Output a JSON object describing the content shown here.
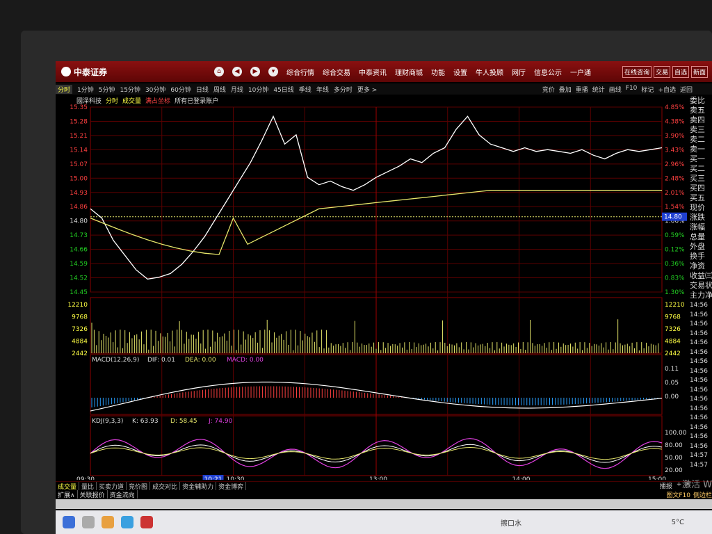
{
  "window": {
    "app_name": "中泰证券"
  },
  "nav": {
    "items": [
      "综合行情",
      "综合交易",
      "中泰资讯",
      "理财商城",
      "功能",
      "设置",
      "牛人投顾",
      "网厅",
      "信息公示",
      "一户通"
    ],
    "right_buttons": [
      "在线咨询",
      "交易",
      "自选",
      "新面"
    ]
  },
  "toolbar": {
    "periods": [
      "分时",
      "1分钟",
      "5分钟",
      "15分钟",
      "30分钟",
      "60分钟",
      "日线",
      "周线",
      "月线",
      "10分钟",
      "45日线",
      "季线",
      "年线",
      "多分时",
      "更多 >"
    ],
    "right": [
      "竞价",
      "叠加",
      "重播",
      "统计",
      "画线",
      "F10",
      "标记",
      "+自选",
      "返回"
    ]
  },
  "legend": {
    "stock": "國泽科技",
    "mode": "分时",
    "volume": "成交量",
    "coord": "满占坐标",
    "accounts": "所有已登录账户"
  },
  "price_axis": {
    "left": [
      "15.35",
      "15.28",
      "15.21",
      "15.14",
      "15.07",
      "15.00",
      "14.93",
      "14.86",
      "14.80",
      "14.73",
      "14.66",
      "14.59",
      "14.52",
      "14.45"
    ],
    "right": [
      "4.85%",
      "4.38%",
      "3.90%",
      "3.43%",
      "2.96%",
      "2.48%",
      "2.01%",
      "1.54%",
      "1.06%",
      "0.59%",
      "0.12%",
      "0.36%",
      "0.83%",
      "1.30%"
    ],
    "current": "14.80"
  },
  "volume_axis": [
    "12210",
    "9768",
    "7326",
    "4884",
    "2442"
  ],
  "macd": {
    "label": "MACD(12,26,9)",
    "dif": "DIF: 0.01",
    "dea": "DEA: 0.00",
    "macd": "MACD: 0.00",
    "axis": [
      "0.11",
      "0.05",
      "0.00"
    ]
  },
  "kdj": {
    "label": "KDJ(9,3,3)",
    "k": "K: 63.93",
    "d": "D: 58.45",
    "j": "J: 74.90",
    "axis": [
      "100.00",
      "80.00",
      "50.00",
      "20.00"
    ]
  },
  "time_axis": {
    "labels": [
      "09:30",
      "10:30",
      "13:00",
      "14:00",
      "15:00"
    ],
    "cursor": "10:21"
  },
  "sidebar": {
    "labels": [
      "委比",
      "卖五",
      "卖四",
      "卖三",
      "卖二",
      "卖一",
      "买一",
      "买二",
      "买三",
      "买四",
      "买五",
      "现价",
      "涨跌",
      "涨幅",
      "总量",
      "外盘",
      "换手",
      "净资",
      "收益㈢",
      "交易状",
      "主力净"
    ],
    "times": [
      "14:56",
      "14:56",
      "14:56",
      "14:56",
      "14:56",
      "14:56",
      "14:56",
      "14:56",
      "14:56",
      "14:56",
      "14:56",
      "14:56",
      "14:56",
      "14:56",
      "14:56",
      "14:56",
      "14:57",
      "14:57"
    ]
  },
  "bottom_tabs": [
    "成交量",
    "量比",
    "买卖力道",
    "竞价图",
    "成交对比",
    "资金辅助力",
    "资金博弈"
  ],
  "bottom_right": [
    "播报",
    "+",
    "<"
  ],
  "sub_tabs": [
    "扩展∧",
    "关联报价",
    "资金流向"
  ],
  "footer_right": [
    "图文F10",
    "侧边栏"
  ],
  "watermark": "激活 W",
  "taskbar": {
    "weather": "5°C",
    "label": "擦口水"
  },
  "colors": {
    "up": "#ff3b3b",
    "down": "#22cc22",
    "price": "#ffffff",
    "avg": "#e6e66a",
    "kdj_j": "#e040e0",
    "accent": "#cc0000"
  }
}
